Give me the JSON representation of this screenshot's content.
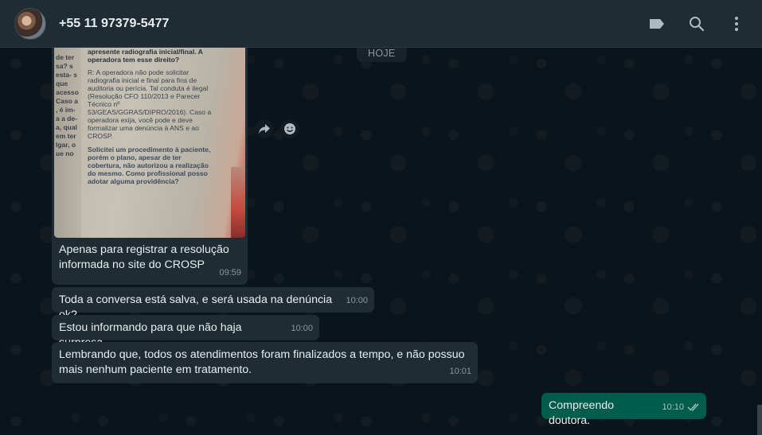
{
  "header": {
    "contact_name": "+55 11 97379-5477",
    "icons": [
      "label-icon",
      "search-icon",
      "menu-icon"
    ]
  },
  "date_chip": "HOJE",
  "image_message": {
    "doc_left_text": "de ter sa? s esta- s que acesso Caso a , é im- a a de- a, qual em ter lgar, o ue no",
    "doc_question": "é necessário que o profissional apresente radiografia inicial/final. A operadora tem esse direito?",
    "doc_answer": "R: A operadora não pode solicitar radiografia inicial e final para fins de auditoria ou perícia. Tal conduta é ilegal (Resolução CFO 110/2013 e Parecer Técnico nº 53/GEAS/GGRAS/DIPRO/2016). Caso a operadora exija, você pode e deve formalizar uma denúncia à ANS e ao CROSP.",
    "doc_question2": "Solicitei um procedimento à paciente, porém o plano, apesar de ter cobertura, não autorizou a realização do mesmo. Como profissional posso adotar alguma providência?",
    "caption": "Apenas para registrar a resolução informada no site do CROSP",
    "time": "09:59"
  },
  "messages": [
    {
      "text": "Toda a conversa está salva, e será usada na denúncia ok?",
      "time": "10:00"
    },
    {
      "text": "Estou informando para que não haja surpresa.",
      "time": "10:00"
    },
    {
      "text": "Lembrando que, todos os atendimentos foram finalizados a tempo, e não possuo mais nenhum paciente em tratamento.",
      "time": "10:01"
    }
  ],
  "outgoing": {
    "text": "Compreendo doutora.",
    "time": "10:10"
  },
  "colors": {
    "header_bg": "#202c33",
    "chat_bg": "#0b141a",
    "incoming_bubble": "#202c33",
    "outgoing_bubble": "#005c4b",
    "text": "#e9edef",
    "meta": "#8696a0"
  }
}
